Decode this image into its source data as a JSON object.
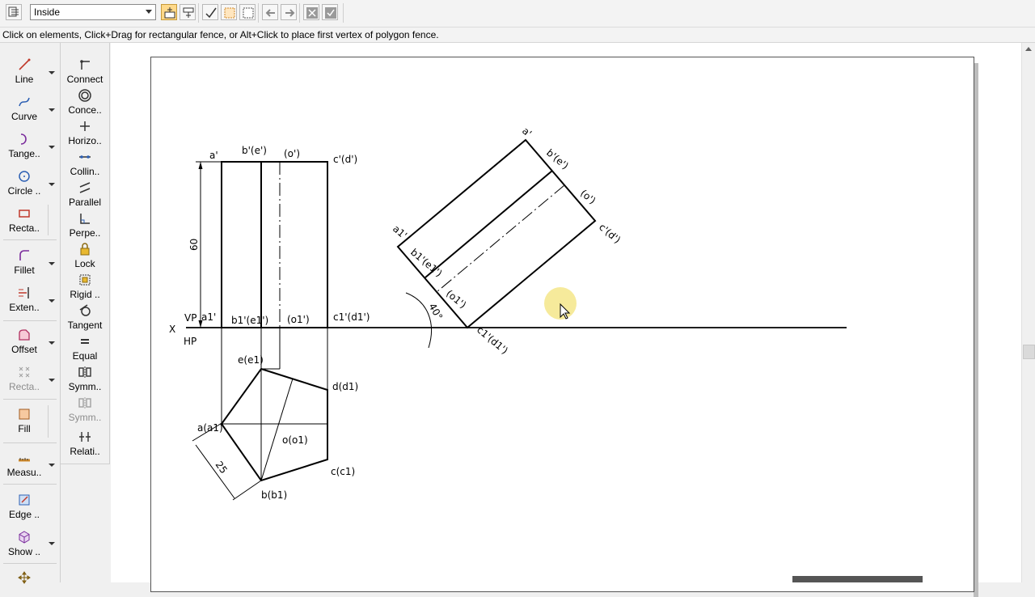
{
  "toolbar": {
    "fence_mode_value": "Inside"
  },
  "status_bar": {
    "message": "Click on elements, Click+Drag for rectangular fence, or Alt+Click to place first vertex of polygon fence."
  },
  "palette": {
    "left": [
      {
        "label": "Line"
      },
      {
        "label": "Curve"
      },
      {
        "label": "Tange.."
      },
      {
        "label": "Circle .."
      },
      {
        "label": "Recta.."
      },
      {
        "label": "Fillet"
      },
      {
        "label": "Exten.."
      },
      {
        "label": "Offset"
      },
      {
        "label": "Recta.."
      },
      {
        "label": "Fill"
      },
      {
        "label": "Measu.."
      },
      {
        "label": "Edge .."
      },
      {
        "label": "Show .."
      }
    ],
    "right": [
      {
        "label": "Connect"
      },
      {
        "label": "Conce.."
      },
      {
        "label": "Horizo.."
      },
      {
        "label": "Collin.."
      },
      {
        "label": "Parallel"
      },
      {
        "label": "Perpe.."
      },
      {
        "label": "Lock"
      },
      {
        "label": "Rigid .."
      },
      {
        "label": "Tangent"
      },
      {
        "label": "Equal"
      },
      {
        "label": "Symm.."
      },
      {
        "label": "Symm.."
      },
      {
        "label": "Relati.."
      }
    ]
  },
  "drawing": {
    "front_labels": {
      "a": "a'",
      "be": "b'(e')",
      "o": "(o')",
      "cd": "c'(d')",
      "a1": "a1'",
      "be1": "b1'(e1')",
      "o1": "(o1')",
      "cd1": "c1'(d1')"
    },
    "dim_height": "60",
    "x_label": "X",
    "vp_label": "VP",
    "hp_label": "HP",
    "top_labels": {
      "e": "e(e1)",
      "d": "d(d1)",
      "a": "a(a1)",
      "o": "o(o1)",
      "c": "c(c1)",
      "b": "b(b1)"
    },
    "dim_side": "25",
    "aux_labels": {
      "a": "a'",
      "be": "b'(e')",
      "o": "(o')",
      "cd": "c'(d')",
      "a1": "a1'",
      "be1": "b1'(e1')",
      "o1": "(o1')",
      "cd1": "c1'(d1')"
    },
    "angle_label": "40°"
  }
}
